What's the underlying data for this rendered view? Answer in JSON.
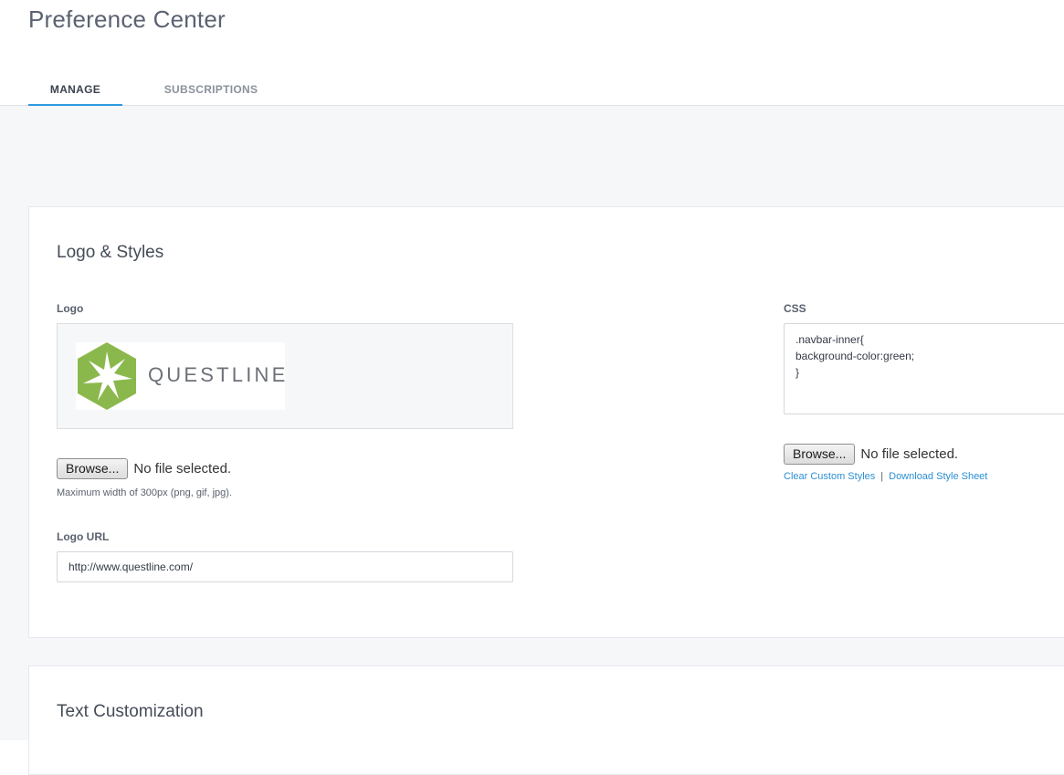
{
  "page": {
    "title": "Preference Center"
  },
  "tabs": [
    {
      "label": "MANAGE",
      "active": true
    },
    {
      "label": "SUBSCRIPTIONS",
      "active": false
    }
  ],
  "logo_styles": {
    "title": "Logo & Styles",
    "logo_label": "Logo",
    "logo_wordmark": "QUESTLINE",
    "logo_browse_label": "Browse...",
    "logo_file_status": "No file selected.",
    "logo_help": "Maximum width of 300px (png, gif, jpg).",
    "logo_url_label": "Logo URL",
    "logo_url_value": "http://www.questline.com/",
    "css_label": "CSS",
    "css_value": ".navbar-inner{\nbackground-color:green;\n}",
    "css_browse_label": "Browse...",
    "css_file_status": "No file selected.",
    "clear_link": "Clear Custom Styles",
    "link_separator": "|",
    "download_link": "Download Style Sheet"
  },
  "text_customization": {
    "title": "Text Customization"
  },
  "colors": {
    "accent": "#2d9be0",
    "link": "#2b8fd6",
    "logo_green": "#8bb84c"
  }
}
